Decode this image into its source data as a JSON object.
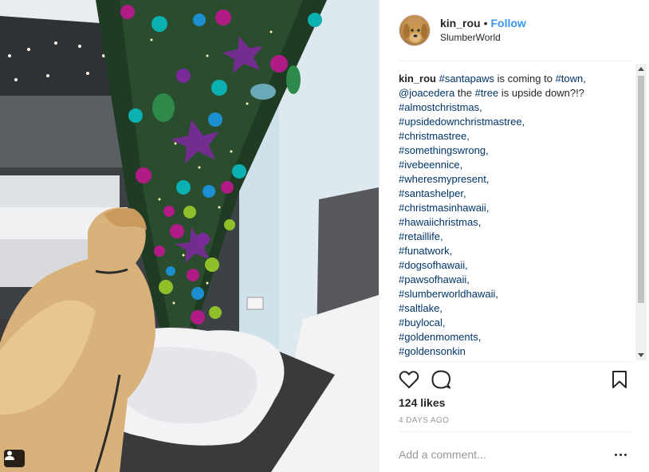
{
  "post": {
    "username": "kin_rou",
    "separator": "•",
    "follow_label": "Follow",
    "location": "SlumberWorld"
  },
  "caption": {
    "username": "kin_rou",
    "parts": [
      {
        "t": "#santapaws",
        "tag": true
      },
      {
        "t": " is coming to ",
        "tag": false
      },
      {
        "t": "#town",
        "tag": true
      },
      {
        "t": ", ",
        "tag": false
      },
      {
        "t": "@joacedera",
        "tag": true
      },
      {
        "t": " the ",
        "tag": false
      },
      {
        "t": "#tree",
        "tag": true
      },
      {
        "t": " is upside down?!?",
        "tag": false
      }
    ],
    "hashtags": [
      "#almostchristmas,",
      "#upsidedownchristmastree,",
      "#christmastree,",
      "#somethingswrong,",
      "#ivebeennice,",
      "#wheresmypresent,",
      "#santashelper,",
      "#christmasinhawaii,",
      "#hawaiichristmas,",
      "#retaillife,",
      "#funatwork,",
      "#dogsofhawaii,",
      "#pawsofhawaii,",
      "#slumberworldhawaii,",
      "#saltlake,",
      "#buylocal,",
      "#goldenmoments,",
      "#goldensonkin"
    ]
  },
  "actions": {
    "like_icon": "heart-icon",
    "comment_icon": "comment-icon",
    "save_icon": "bookmark-icon"
  },
  "likes": {
    "count": "124",
    "label": " likes"
  },
  "timestamp": "4 DAYS AGO",
  "comment": {
    "placeholder": "Add a comment..."
  },
  "colors": {
    "link": "#3897f0",
    "hashtag": "#003569",
    "text": "#262626",
    "muted": "#999999"
  }
}
